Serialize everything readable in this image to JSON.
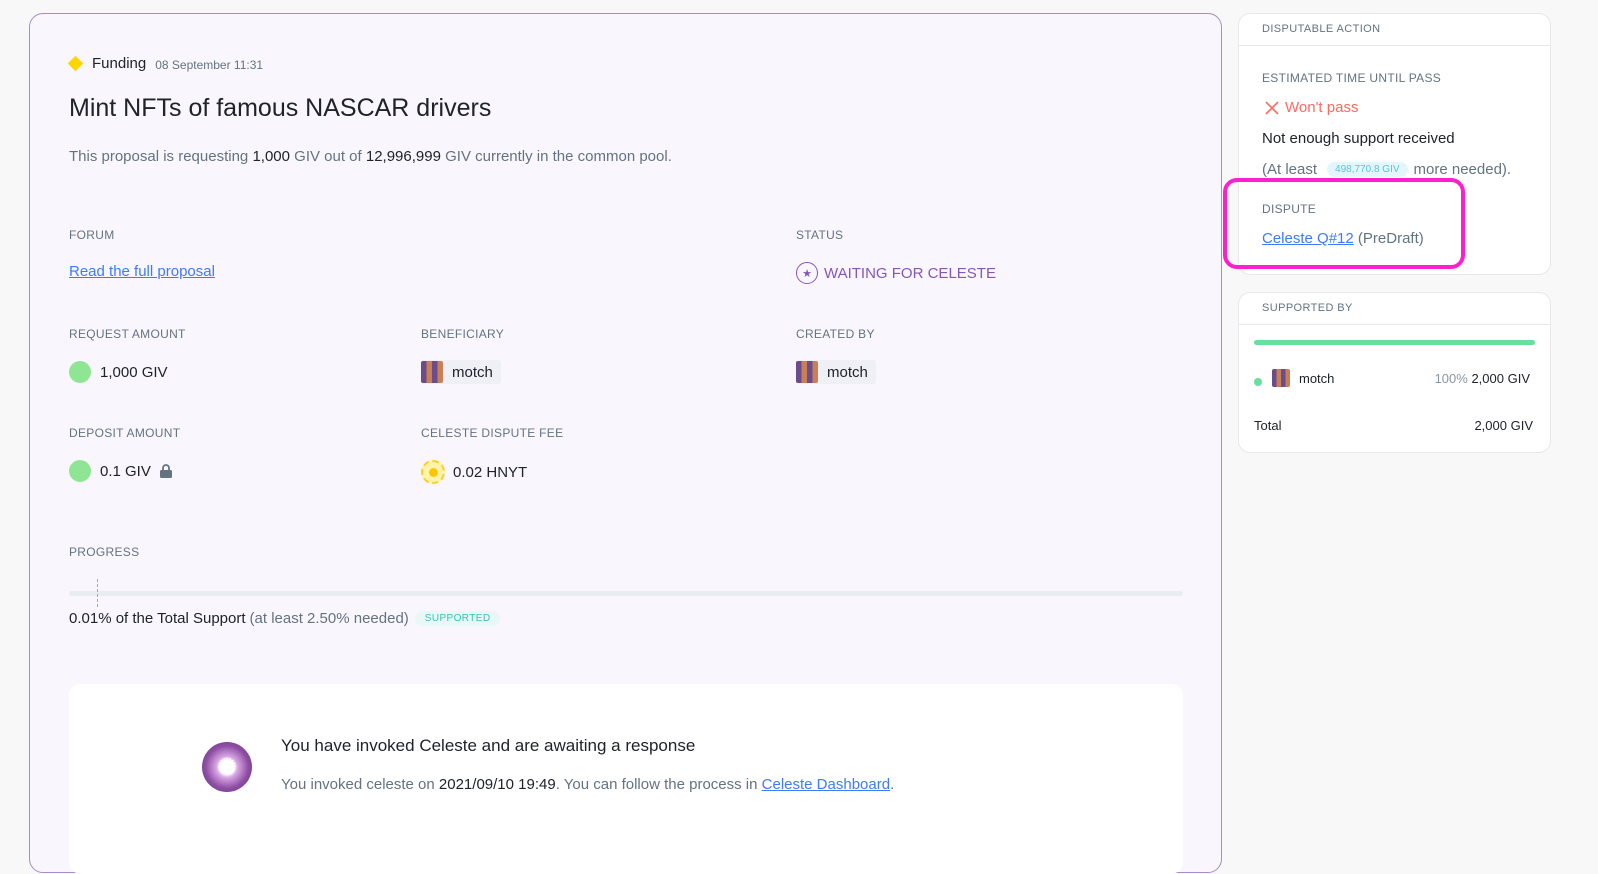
{
  "proposal": {
    "type": "Funding",
    "date": "08 September 11:31",
    "title": "Mint NFTs of famous NASCAR drivers",
    "description": {
      "prefix": "This proposal is requesting ",
      "amount": "1,000",
      "mid": " GIV out of ",
      "pool": "12,996,999",
      "suffix": " GIV currently in the common pool."
    }
  },
  "fields": {
    "forum_label": "FORUM",
    "forum_link": "Read the full proposal",
    "status_label": "STATUS",
    "status_value": "WAITING FOR CELESTE",
    "request_label": "REQUEST AMOUNT",
    "request_value": "1,000 GIV",
    "beneficiary_label": "BENEFICIARY",
    "beneficiary_value": "motch",
    "created_label": "CREATED BY",
    "created_value": "motch",
    "deposit_label": "DEPOSIT AMOUNT",
    "deposit_value": "0.1 GIV",
    "fee_label": "CELESTE DISPUTE FEE",
    "fee_value": "0.02 HNYT"
  },
  "progress": {
    "label": "PROGRESS",
    "value_text": "0.01% of the Total Support",
    "needed_text": "(at least 2.50% needed)",
    "badge": "SUPPORTED",
    "support_fraction": 0.0001,
    "threshold_fraction": 0.025
  },
  "celeste_info": {
    "title": "You have invoked Celeste and are awaiting a response",
    "sub_prefix": "You invoked celeste on ",
    "sub_date": "2021/09/10 19:49",
    "sub_mid": ". You can follow the process in ",
    "sub_link": "Celeste Dashboard",
    "sub_suffix": "."
  },
  "disputable": {
    "header": "DISPUTABLE ACTION",
    "time_label": "ESTIMATED TIME UNTIL PASS",
    "wont_pass": "Won't pass",
    "not_enough": "Not enough support received",
    "at_least_prefix": "(At least",
    "at_least_amount": "498,770.8 GIV",
    "at_least_suffix": "more needed).",
    "dispute_label": "DISPUTE",
    "dispute_link": "Celeste Q#12",
    "dispute_state": "(PreDraft)"
  },
  "supported_by": {
    "header": "SUPPORTED BY",
    "supporter_name": "motch",
    "supporter_percent": "100%",
    "supporter_amount": "2,000 GIV",
    "total_label": "Total",
    "total_value": "2,000 GIV"
  },
  "colors": {
    "accent_purple": "#8557b5",
    "link_blue": "#3e7bfa",
    "highlight_magenta": "#ff1fd1",
    "support_green": "#67e09c"
  }
}
